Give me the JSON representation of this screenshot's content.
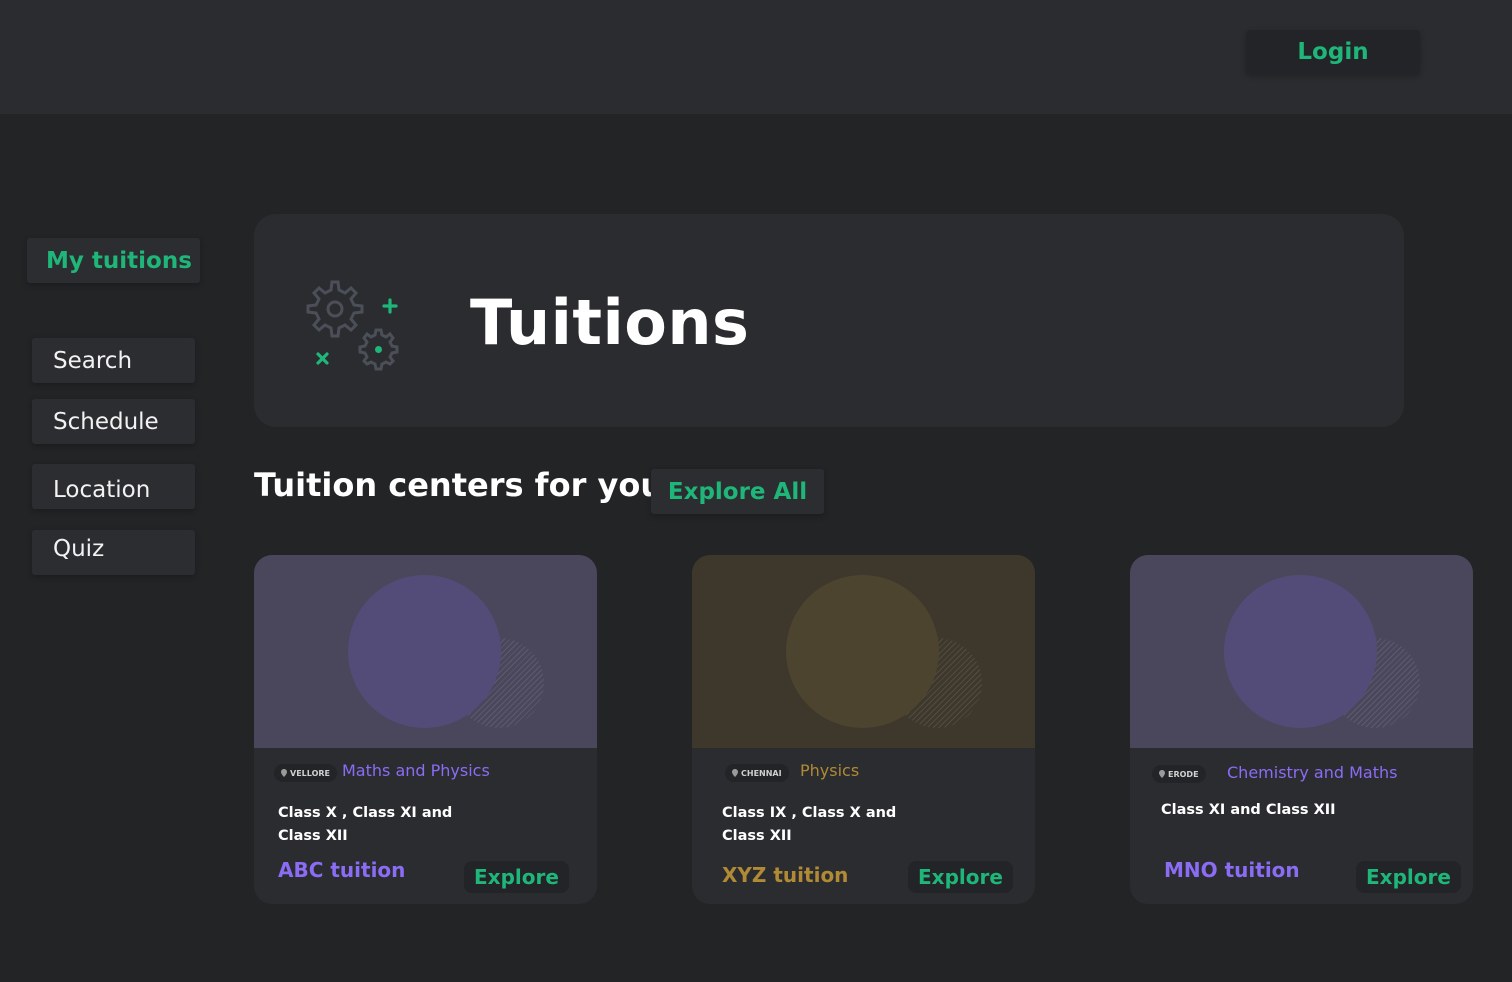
{
  "header": {
    "login_label": "Login"
  },
  "sidebar": {
    "active_label": "My tuitions",
    "items": [
      {
        "label": "Search"
      },
      {
        "label": "Schedule"
      },
      {
        "label": "Location"
      },
      {
        "label": "Quiz"
      }
    ]
  },
  "hero": {
    "title": "Tuitions",
    "icon": "gears-plus-cross-icon"
  },
  "section": {
    "title": "Tuition centers for you",
    "explore_all_label": "Explore All"
  },
  "cards": [
    {
      "location": "VELLORE",
      "subjects": "Maths and Physics",
      "classes_line1": "Class X  , Class XI and",
      "classes_line2": "Class XII",
      "name": "ABC tuition",
      "explore_label": "Explore",
      "accent": "#8b6cf5",
      "banner_color": "#4a475c",
      "circle_color": "#544c78"
    },
    {
      "location": "CHENNAI",
      "subjects": "Physics",
      "classes_line1": "Class IX  , Class X and",
      "classes_line2": "Class XII",
      "name": "XYZ tuition",
      "explore_label": "Explore",
      "accent": "#b08a35",
      "banner_color": "#3e372c",
      "circle_color": "#4d4430"
    },
    {
      "location": "ERODE",
      "subjects": "Chemistry and Maths",
      "classes_line1": "Class XI and Class XII",
      "classes_line2": "",
      "name": "MNO tuition",
      "explore_label": "Explore",
      "accent": "#8b6cf5",
      "banner_color": "#4a475c",
      "circle_color": "#544c78"
    }
  ],
  "colors": {
    "background": "#232426",
    "topbar": "#2b2c2f",
    "green_accent": "#1fb67a"
  }
}
